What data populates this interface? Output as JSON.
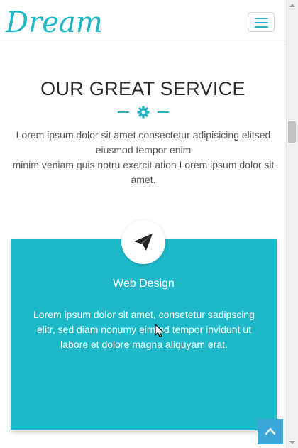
{
  "header": {
    "brand": "Dream",
    "menu_icon": "hamburger-icon"
  },
  "section": {
    "title": "OUR GREAT SERVICE",
    "divider_icon": "gear-icon",
    "intro_line1": "Lorem ipsum dolor sit amet consectetur adipisicing elitsed eiusmod tempor enim",
    "intro_line2": "minim veniam quis notru exercit ation Lorem ipsum dolor sit amet."
  },
  "service_card": {
    "icon": "paper-plane-icon",
    "title": "Web Design",
    "text": "Lorem ipsum dolor sit amet, consetetur sadipscing elitr, sed diam nonumy eirmod tempor invidunt ut labore et dolore magna aliquyam erat."
  },
  "back_to_top": {
    "icon": "chevron-up-icon"
  },
  "colors": {
    "accent": "#1fb5c7",
    "card_bg": "#1fb8c8",
    "back_to_top_bg": "#3aa7d8",
    "title_text": "#2a2a2a",
    "body_text": "#555555"
  }
}
